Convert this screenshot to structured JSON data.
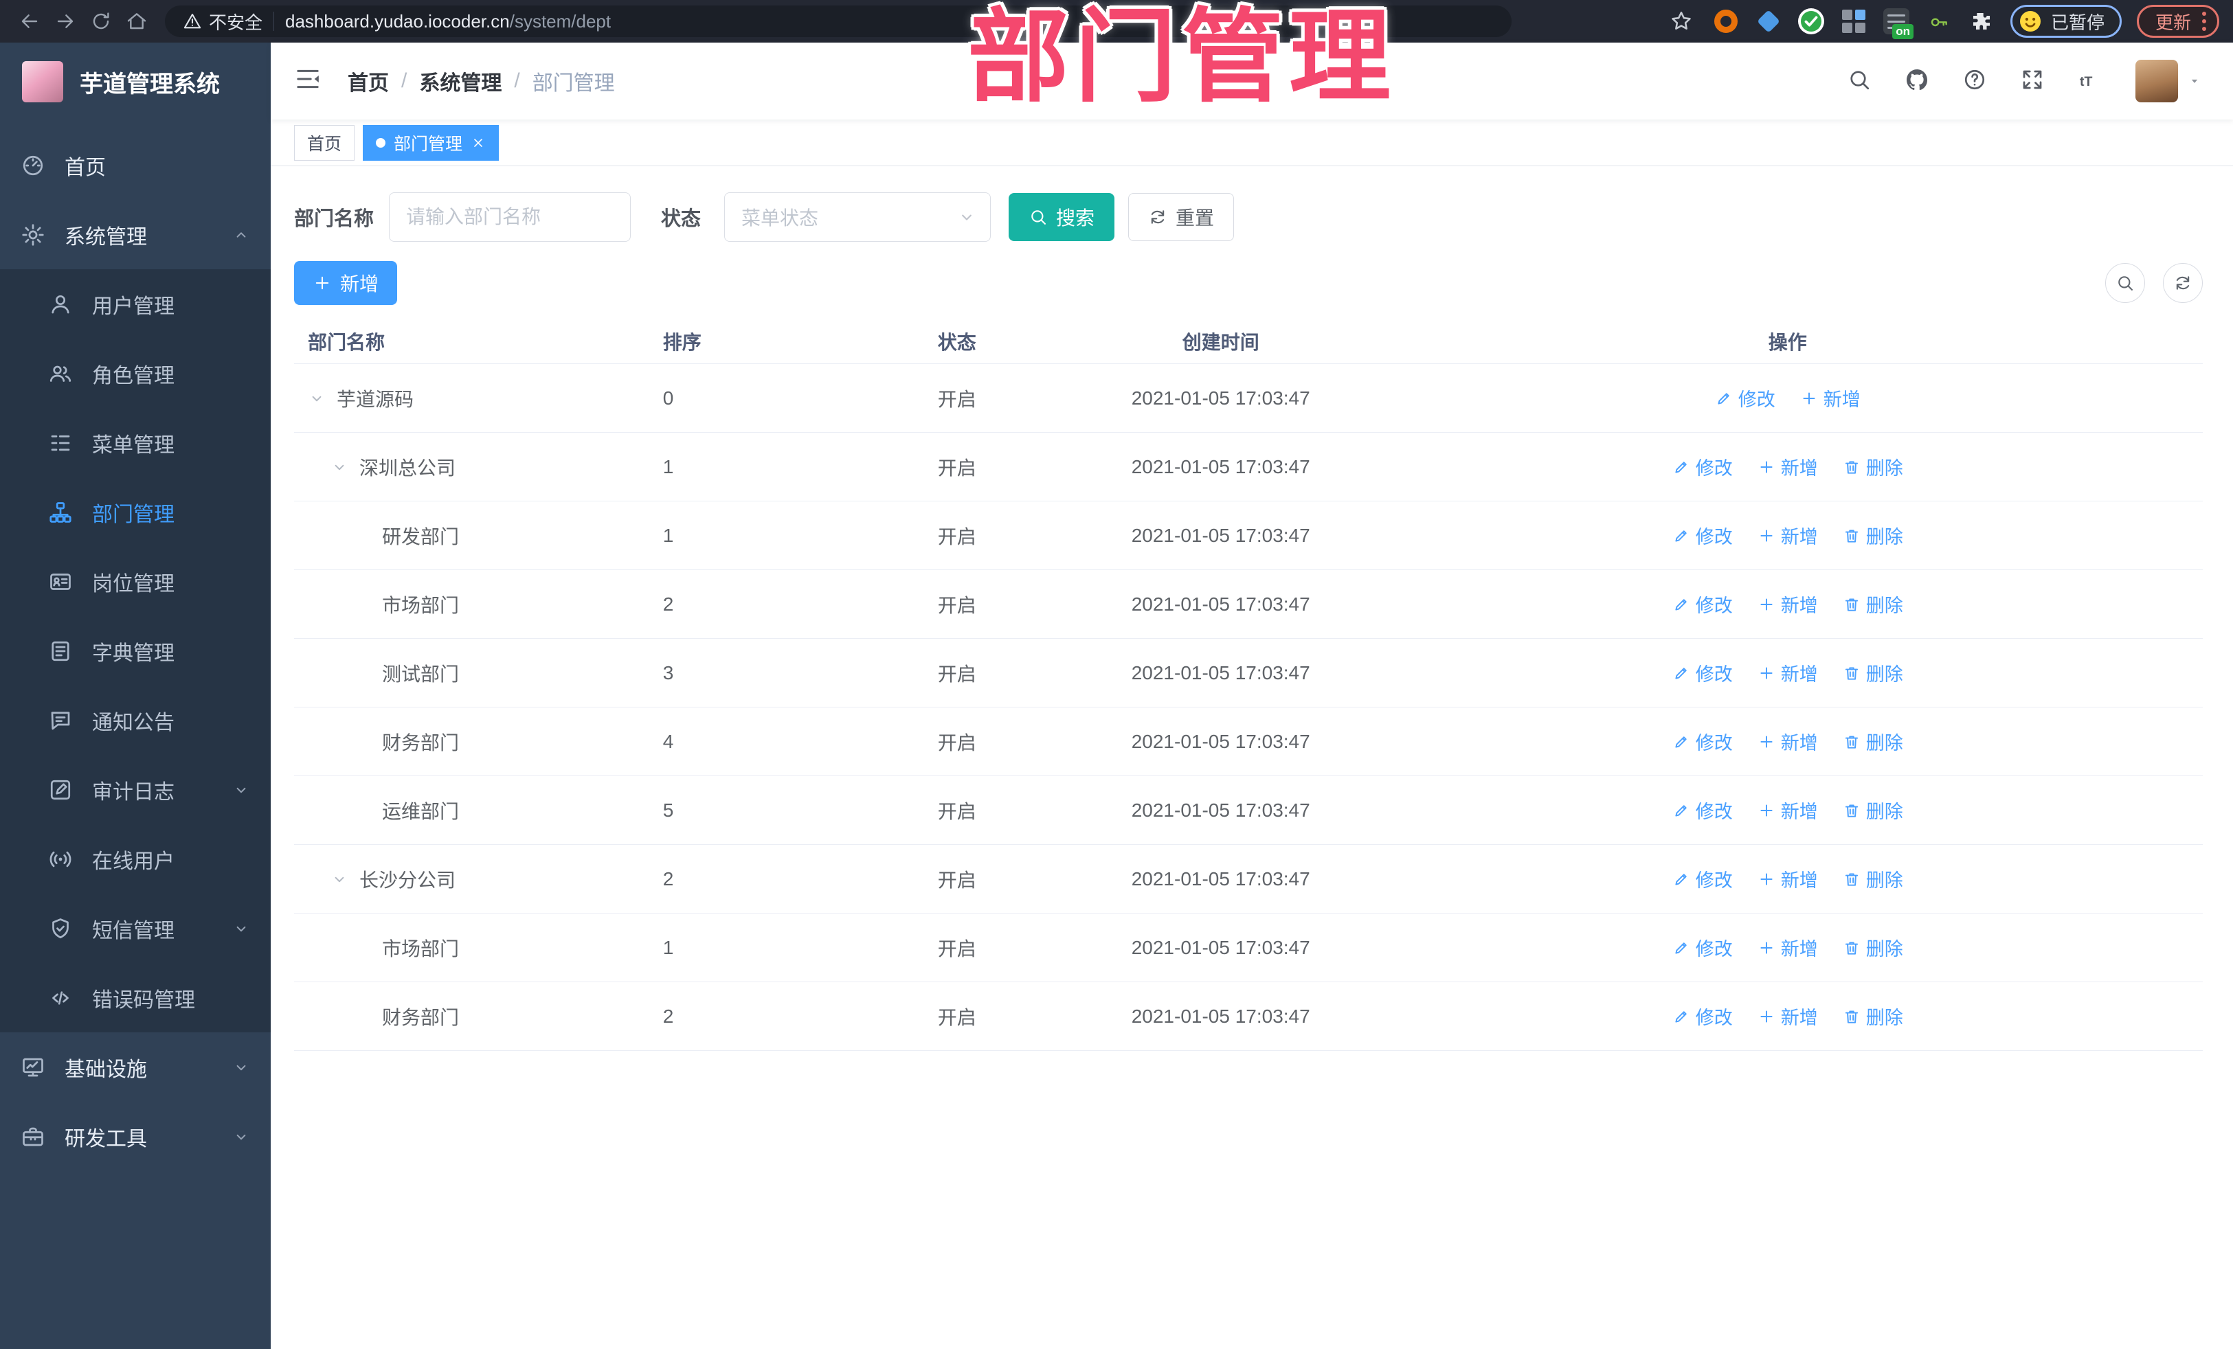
{
  "colors": {
    "accent": "#409eff",
    "search_teal": "#17b3a3",
    "overlay_pink": "#f4486e",
    "sidebar_bg": "#304156",
    "submenu_bg": "#263445",
    "link_blue": "#4aa0ff"
  },
  "overlay": {
    "title": "部门管理"
  },
  "browser": {
    "security_label": "不安全",
    "url_host": "dashboard.yudao.iocoder.cn",
    "url_path": "/system/dept",
    "extension_badge": "on",
    "paused_label": "已暂停",
    "update_label": "更新"
  },
  "sidebar": {
    "title": "芋道管理系统",
    "items": [
      {
        "label": "首页",
        "icon": "gauge",
        "level": "top"
      },
      {
        "label": "系统管理",
        "icon": "gear",
        "level": "top",
        "chevron": "up",
        "expanded": true
      },
      {
        "label": "用户管理",
        "icon": "user",
        "level": "sub"
      },
      {
        "label": "角色管理",
        "icon": "users",
        "level": "sub"
      },
      {
        "label": "菜单管理",
        "icon": "menu-tree",
        "level": "sub"
      },
      {
        "label": "部门管理",
        "icon": "sitemap",
        "level": "sub",
        "active": true
      },
      {
        "label": "岗位管理",
        "icon": "idcard",
        "level": "sub"
      },
      {
        "label": "字典管理",
        "icon": "book",
        "level": "sub"
      },
      {
        "label": "通知公告",
        "icon": "announcement",
        "level": "sub"
      },
      {
        "label": "审计日志",
        "icon": "audit",
        "level": "sub",
        "chevron": "down"
      },
      {
        "label": "在线用户",
        "icon": "online",
        "level": "sub"
      },
      {
        "label": "短信管理",
        "icon": "shield",
        "level": "sub",
        "chevron": "down"
      },
      {
        "label": "错误码管理",
        "icon": "code",
        "level": "sub"
      },
      {
        "label": "基础设施",
        "icon": "monitor",
        "level": "top",
        "chevron": "down"
      },
      {
        "label": "研发工具",
        "icon": "toolbox",
        "level": "top",
        "chevron": "down"
      }
    ]
  },
  "header": {
    "breadcrumb": [
      "首页",
      "系统管理",
      "部门管理"
    ]
  },
  "tabs": [
    {
      "label": "首页",
      "active": false,
      "closable": false
    },
    {
      "label": "部门管理",
      "active": true,
      "closable": true
    }
  ],
  "filter": {
    "name_label": "部门名称",
    "name_placeholder": "请输入部门名称",
    "status_label": "状态",
    "status_placeholder": "菜单状态",
    "search_label": "搜索",
    "reset_label": "重置"
  },
  "toolbar": {
    "add_label": "新增"
  },
  "table": {
    "columns": [
      "部门名称",
      "排序",
      "状态",
      "创建时间",
      "操作"
    ],
    "actions": {
      "modify": "修改",
      "add": "新增",
      "delete": "删除"
    },
    "rows": [
      {
        "name": "芋道源码",
        "level": 0,
        "expandable": true,
        "sort": "0",
        "status": "开启",
        "created": "2021-01-05 17:03:47",
        "deletable": false
      },
      {
        "name": "深圳总公司",
        "level": 1,
        "expandable": true,
        "sort": "1",
        "status": "开启",
        "created": "2021-01-05 17:03:47",
        "deletable": true
      },
      {
        "name": "研发部门",
        "level": 2,
        "expandable": false,
        "sort": "1",
        "status": "开启",
        "created": "2021-01-05 17:03:47",
        "deletable": true
      },
      {
        "name": "市场部门",
        "level": 2,
        "expandable": false,
        "sort": "2",
        "status": "开启",
        "created": "2021-01-05 17:03:47",
        "deletable": true
      },
      {
        "name": "测试部门",
        "level": 2,
        "expandable": false,
        "sort": "3",
        "status": "开启",
        "created": "2021-01-05 17:03:47",
        "deletable": true
      },
      {
        "name": "财务部门",
        "level": 2,
        "expandable": false,
        "sort": "4",
        "status": "开启",
        "created": "2021-01-05 17:03:47",
        "deletable": true
      },
      {
        "name": "运维部门",
        "level": 2,
        "expandable": false,
        "sort": "5",
        "status": "开启",
        "created": "2021-01-05 17:03:47",
        "deletable": true
      },
      {
        "name": "长沙分公司",
        "level": 1,
        "expandable": true,
        "sort": "2",
        "status": "开启",
        "created": "2021-01-05 17:03:47",
        "deletable": true
      },
      {
        "name": "市场部门",
        "level": 2,
        "expandable": false,
        "sort": "1",
        "status": "开启",
        "created": "2021-01-05 17:03:47",
        "deletable": true
      },
      {
        "name": "财务部门",
        "level": 2,
        "expandable": false,
        "sort": "2",
        "status": "开启",
        "created": "2021-01-05 17:03:47",
        "deletable": true
      }
    ]
  }
}
